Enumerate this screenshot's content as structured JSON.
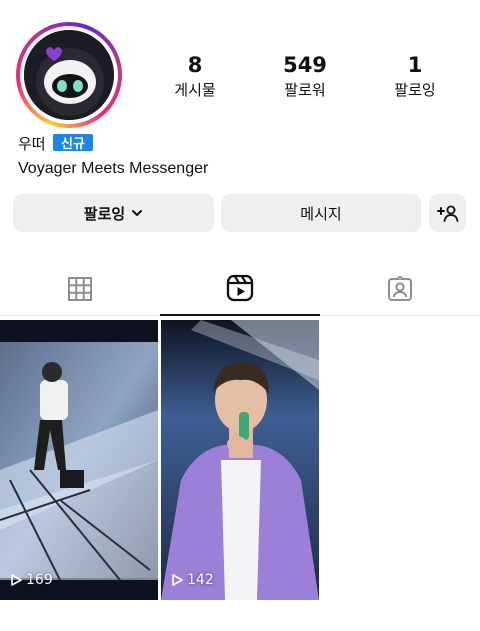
{
  "profile": {
    "badge": "신규",
    "name": "우떠",
    "bio": "Voyager Meets Messenger",
    "avatar_icon": "robot-mascot-avatar"
  },
  "stats": [
    {
      "value": "8",
      "label": "게시물"
    },
    {
      "value": "549",
      "label": "팔로워"
    },
    {
      "value": "1",
      "label": "팔로잉"
    }
  ],
  "actions": {
    "following_label": "팔로잉",
    "message_label": "메시지",
    "add_user_icon": "person-add-icon"
  },
  "tabs": [
    {
      "icon": "grid-icon",
      "active": false
    },
    {
      "icon": "reels-icon",
      "active": true
    },
    {
      "icon": "tagged-icon",
      "active": false
    }
  ],
  "reels": [
    {
      "views": "169"
    },
    {
      "views": "142"
    }
  ],
  "colors": {
    "button_bg": "#efefef",
    "badge_blue": "#1b86e8",
    "hoodie_purple": "#9c7fd8"
  }
}
